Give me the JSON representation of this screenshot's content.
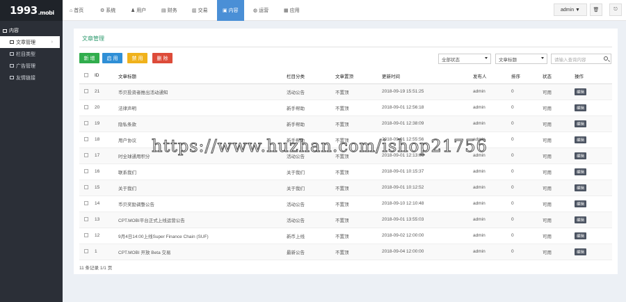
{
  "logo": {
    "main": "1993",
    "suffix": ".mobi"
  },
  "sidebar": {
    "section": "内容",
    "items": [
      {
        "label": "文章管理",
        "active": true
      },
      {
        "label": "栏目类型",
        "active": false
      },
      {
        "label": "广告管理",
        "active": false
      },
      {
        "label": "友情链接",
        "active": false
      }
    ]
  },
  "topnav": {
    "items": [
      {
        "label": "首页",
        "icon": "home-icon",
        "glyph": "⌂"
      },
      {
        "label": "系统",
        "icon": "gear-icon",
        "glyph": "⚙"
      },
      {
        "label": "用户",
        "icon": "user-icon",
        "glyph": "♟"
      },
      {
        "label": "财务",
        "icon": "finance-icon",
        "glyph": "▤"
      },
      {
        "label": "交易",
        "icon": "chart-icon",
        "glyph": "▥"
      },
      {
        "label": "内容",
        "icon": "content-icon",
        "glyph": "▣"
      },
      {
        "label": "运营",
        "icon": "globe-icon",
        "glyph": "◍"
      },
      {
        "label": "应用",
        "icon": "apps-icon",
        "glyph": "▦"
      }
    ],
    "admin_label": "admin ▼",
    "trash_glyph": "🗑",
    "logout_glyph": "⎋"
  },
  "panel": {
    "title": "文章管理",
    "buttons": {
      "add": "新 增",
      "enable": "启 用",
      "disable": "禁 用",
      "delete": "删 除"
    },
    "filter_status": "全部状态",
    "filter_field": "文章标题",
    "search_placeholder": "请输入查询内容"
  },
  "table": {
    "headers": [
      "ID",
      "文章标题",
      "栏目分类",
      "文章置顶",
      "更新时间",
      "发布人",
      "排序",
      "状态",
      "操作"
    ],
    "rows": [
      {
        "id": "21",
        "title": "币贝投资者推出活动通知",
        "category": "活动公告",
        "top": "不置顶",
        "time": "2018-09-19 15:51:25",
        "author": "admin",
        "sort": "0",
        "status": "可用",
        "action": "编辑"
      },
      {
        "id": "20",
        "title": "法律声明",
        "category": "新手帮助",
        "top": "不置顶",
        "time": "2018-09-01 12:56:18",
        "author": "admin",
        "sort": "0",
        "status": "可用",
        "action": "编辑"
      },
      {
        "id": "19",
        "title": "隐私条款",
        "category": "新手帮助",
        "top": "不置顶",
        "time": "2018-09-01 12:38:09",
        "author": "admin",
        "sort": "0",
        "status": "可用",
        "action": "编辑"
      },
      {
        "id": "18",
        "title": "用户协议",
        "category": "新手帮助",
        "top": "不置顶",
        "time": "2018-09-01 12:55:56",
        "author": "admin",
        "sort": "0",
        "status": "可用",
        "action": "编辑"
      },
      {
        "id": "17",
        "title": "时全球通用积分",
        "category": "活动公告",
        "top": "不置顶",
        "time": "2018-09-01 12:13:06",
        "author": "admin",
        "sort": "0",
        "status": "可用",
        "action": "编辑"
      },
      {
        "id": "16",
        "title": "联系我们",
        "category": "关于我们",
        "top": "不置顶",
        "time": "2018-09-01 10:15:37",
        "author": "admin",
        "sort": "0",
        "status": "可用",
        "action": "编辑"
      },
      {
        "id": "15",
        "title": "关于我们",
        "category": "关于我们",
        "top": "不置顶",
        "time": "2018-09-01 10:12:52",
        "author": "admin",
        "sort": "0",
        "status": "可用",
        "action": "编辑"
      },
      {
        "id": "14",
        "title": "币贝奖励调整公告",
        "category": "活动公告",
        "top": "不置顶",
        "time": "2018-09-10 12:10:48",
        "author": "admin",
        "sort": "0",
        "status": "可用",
        "action": "编辑"
      },
      {
        "id": "13",
        "title": "CPT.MOBI平台正式上线运营公告",
        "category": "活动公告",
        "top": "不置顶",
        "time": "2018-09-01 13:55:03",
        "author": "admin",
        "sort": "0",
        "status": "可用",
        "action": "编辑"
      },
      {
        "id": "12",
        "title": "9月4日14:00上线Super Finance Chain (SUF)",
        "category": "新币上线",
        "top": "不置顶",
        "time": "2018-09-02 12:00:00",
        "author": "admin",
        "sort": "0",
        "status": "可用",
        "action": "编辑"
      },
      {
        "id": "1",
        "title": "CPT.MOBI 开放 Beta 交易",
        "category": "最新公告",
        "top": "不置顶",
        "time": "2018-09-04 12:00:00",
        "author": "admin",
        "sort": "0",
        "status": "可用",
        "action": "编辑"
      }
    ],
    "footer": "11 条记录 1/1 页"
  },
  "watermark": "https://www.huzhan.com/ishop21756"
}
